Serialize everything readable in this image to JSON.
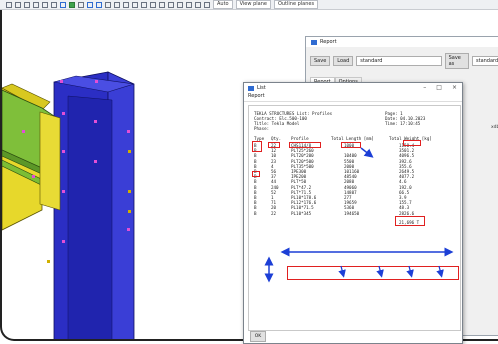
{
  "toolbar": {
    "dropdowns": [
      "Auto",
      "View plane",
      "Outline planes"
    ]
  },
  "report_window": {
    "title": "Report",
    "save_label": "Save",
    "load_label": "Load",
    "load_value": "standard",
    "save_as_label": "Save as",
    "save_as_value": "standard",
    "tabs": [
      "Report",
      "Options"
    ],
    "side_text": "xdb"
  },
  "list_window": {
    "title": "List",
    "menu": "Report",
    "ok_label": "OK",
    "header": {
      "line1_left": "TEKLA STRUCTURES List: Profiles",
      "line1_right": "Page: 1",
      "line2_left": "Contract: Elc.500-100",
      "line2_right": "Date: 04.10.2023",
      "line3_left": "Title: Tekla Model",
      "line3_right": "Time: 17:10:45",
      "line4_left": "Phase:"
    },
    "columns": [
      "Type",
      "Qty.",
      "Profile",
      "Total Length [mm]",
      "Total Weight [kg]"
    ],
    "rows": [
      [
        "B",
        "22",
        "CHS114/8",
        "1000",
        "1150.4"
      ],
      [
        "B",
        "12",
        "PLT25*260",
        "",
        "3501.2"
      ],
      [
        "B",
        "10",
        "PLT20*200",
        "10400",
        "4096.5"
      ],
      [
        "B",
        "23",
        "PLT20*500",
        "5500",
        "392.6"
      ],
      [
        "B",
        "4",
        "PLT35*500",
        "2000",
        "355.6"
      ],
      [
        "B",
        "56",
        "IPE300",
        "101160",
        "2649.5"
      ],
      [
        "B",
        "37",
        "IPE200",
        "48540",
        "4077.2"
      ],
      [
        "B",
        "44",
        "PLT*50",
        "2080",
        "4.6"
      ],
      [
        "B",
        "240",
        "PLT*47.2",
        "49060",
        "192.0"
      ],
      [
        "B",
        "52",
        "PLT*71.5",
        "14807",
        "66.5"
      ],
      [
        "B",
        "1",
        "PL10*178.6",
        "277",
        "3.9"
      ],
      [
        "B",
        "71",
        "PL12*176.6",
        "19659",
        "155.7"
      ],
      [
        "B",
        "20",
        "PL10*71.5",
        "5360",
        "48.3"
      ],
      [
        "B",
        "22",
        "PL10*345",
        "194650",
        "2826.6"
      ]
    ],
    "total_weight": "21,696 T"
  }
}
